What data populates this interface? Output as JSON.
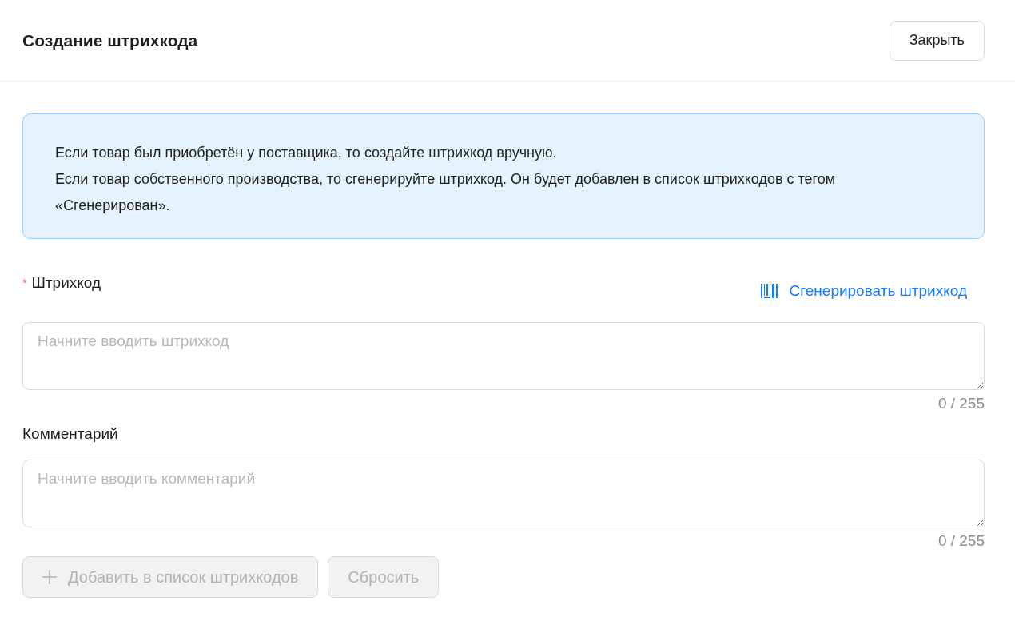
{
  "header": {
    "title": "Создание штрихкода",
    "close_button": "Закрыть"
  },
  "info": [
    "Если товар был приобретён у поставщика, то создайте штрихкод вручную.",
    "Если товар собственного производства, то сгенерируйте штрихкод. Он будет добавлен в список штрихкодов с тегом «Сгенерирован»."
  ],
  "fields": [
    {
      "label": "Штрихкод",
      "required_mark": "*",
      "action": "Сгенерировать штрихкод",
      "placeholder": "Начните вводить штрихкод",
      "counter": "0 / 255"
    },
    {
      "label": "Комментарий",
      "placeholder": "Начните вводить комментарий",
      "counter": "0 / 255"
    }
  ],
  "buttons": [
    {
      "label": "Добавить в список штрихкодов",
      "kind": "add",
      "disabled": true
    },
    {
      "label": "Сбросить",
      "kind": "plain",
      "disabled": true
    }
  ]
}
